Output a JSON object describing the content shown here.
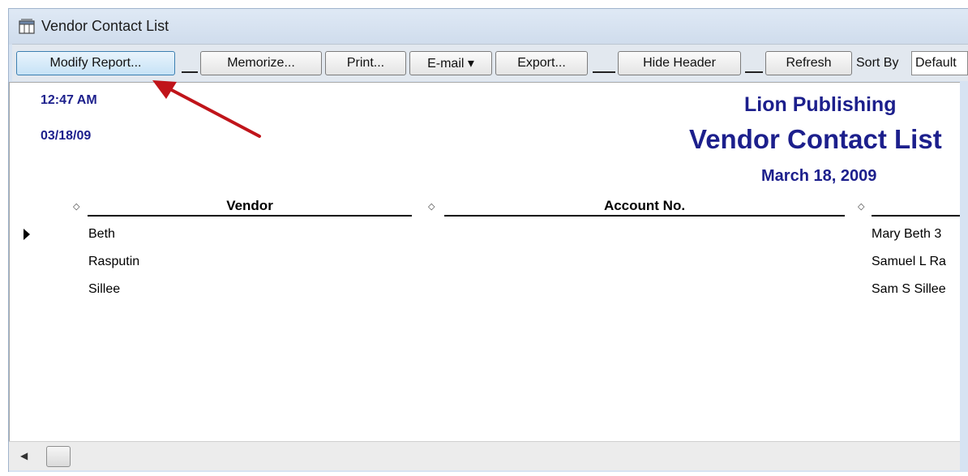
{
  "window": {
    "title": "Vendor Contact List",
    "icon": "report-window-icon"
  },
  "toolbar": {
    "buttons": [
      {
        "label": "Modify Report...",
        "active": true
      },
      {
        "label": "Memorize..."
      },
      {
        "label": "Print..."
      },
      {
        "label": "E-mail ▾"
      },
      {
        "label": "Export..."
      },
      {
        "label": "Hide Header"
      },
      {
        "label": "Refresh"
      }
    ],
    "sort_by_label": "Sort By",
    "sort_by_value": "Default"
  },
  "report": {
    "time": "12:47 AM",
    "date": "03/18/09",
    "company": "Lion Publishing",
    "title": "Vendor Contact List",
    "period": "March 18, 2009",
    "columns": [
      "Vendor",
      "Account No.",
      ""
    ],
    "rows": [
      {
        "vendor": "Beth",
        "account_no": "",
        "contact": "Mary Beth 3"
      },
      {
        "vendor": "Rasputin",
        "account_no": "",
        "contact": "Samuel L Ra"
      },
      {
        "vendor": "Sillee",
        "account_no": "",
        "contact": "Sam S Sillee"
      }
    ]
  },
  "colors": {
    "header_text": "#1c1f8c",
    "annotation_arrow": "#c0141a",
    "active_button": "#c6e2f6"
  }
}
